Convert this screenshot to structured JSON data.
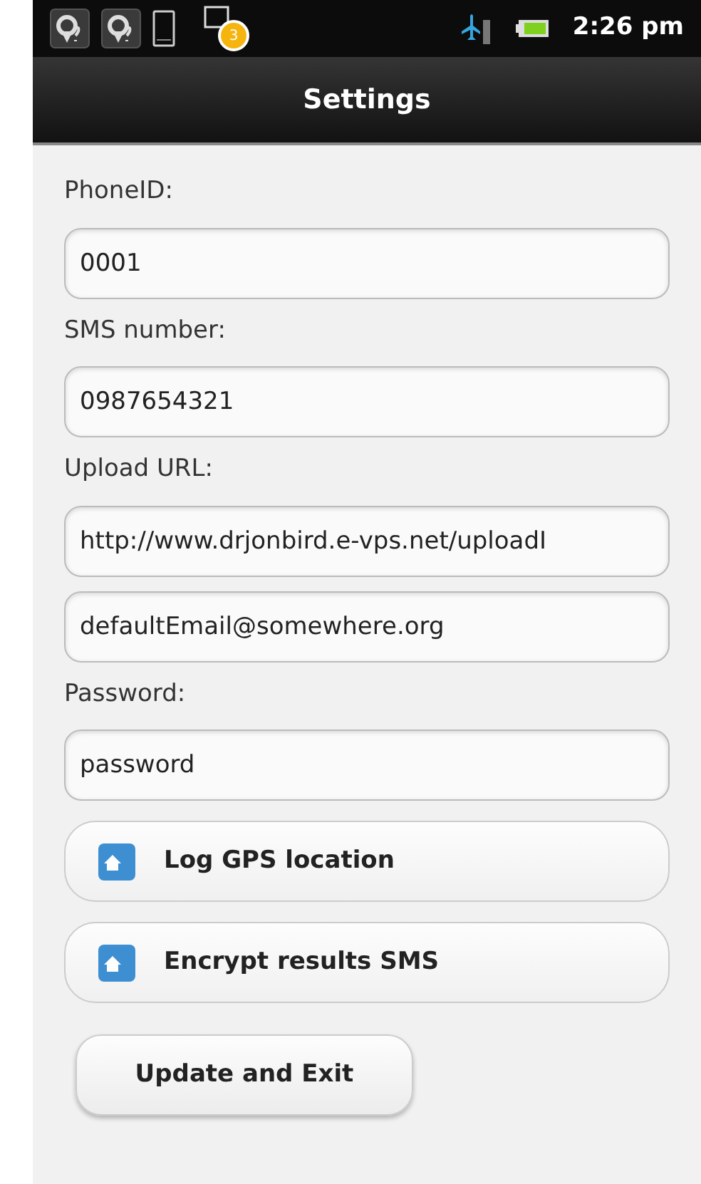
{
  "status_bar": {
    "notification_count": "3",
    "time": "2:26 pm"
  },
  "header": {
    "title": "Settings"
  },
  "fields": [
    {
      "label": "PhoneID:",
      "value": "0001"
    },
    {
      "label": "SMS number:",
      "value": "0987654321"
    },
    {
      "label": "Upload URL:",
      "value": "http://www.drjonbird.e-vps.net/uploadI"
    },
    {
      "value": "defaultEmail@somewhere.org"
    },
    {
      "label": "Password:",
      "value": "password"
    }
  ],
  "options": [
    {
      "label": "Log GPS location"
    },
    {
      "label": "Encrypt results SMS"
    }
  ],
  "submit": {
    "label": "Update and Exit"
  }
}
